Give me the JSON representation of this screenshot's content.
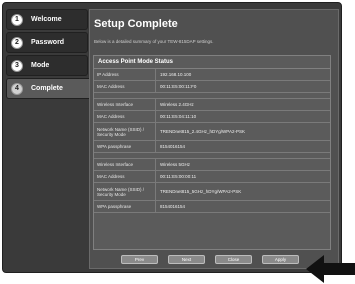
{
  "sidebar": {
    "items": [
      {
        "number": "1",
        "label": "Welcome"
      },
      {
        "number": "2",
        "label": "Password"
      },
      {
        "number": "3",
        "label": "Mode"
      },
      {
        "number": "4",
        "label": "Complete"
      }
    ]
  },
  "main": {
    "title": "Setup Complete",
    "subtitle": "Below is a detailed summary of your TEW-815DAP settings.",
    "panel_title": "Access Point Mode Status",
    "groups": [
      [
        {
          "label": "IP Address",
          "value": "192.168.10.100"
        },
        {
          "label": "MAC Address",
          "value": "00:11:E5:00:11:F0"
        }
      ],
      [
        {
          "label": "Wireless Interface",
          "value": "Wireless 2.4GHz"
        },
        {
          "label": "MAC Address",
          "value": "00:11:E5:04:11:10"
        },
        {
          "label": "Network Name (SSID) / Security Mode",
          "value": "TRENDnet815_2.4GHz_hDYg/WPA2-PSK"
        },
        {
          "label": "WPA passphrase",
          "value": "8154016154"
        }
      ],
      [
        {
          "label": "Wireless Interface",
          "value": "Wireless 5GHz"
        },
        {
          "label": "MAC Address",
          "value": "00:11:E5:00:00:11"
        },
        {
          "label": "Network Name (SSID) / Security Mode",
          "value": "TRENDnet815_5GHz_hDYg/WPA2-PSK"
        },
        {
          "label": "WPA passphrase",
          "value": "8154016154"
        }
      ]
    ],
    "buttons": [
      "Prev",
      "Next",
      "Close",
      "Apply"
    ]
  }
}
